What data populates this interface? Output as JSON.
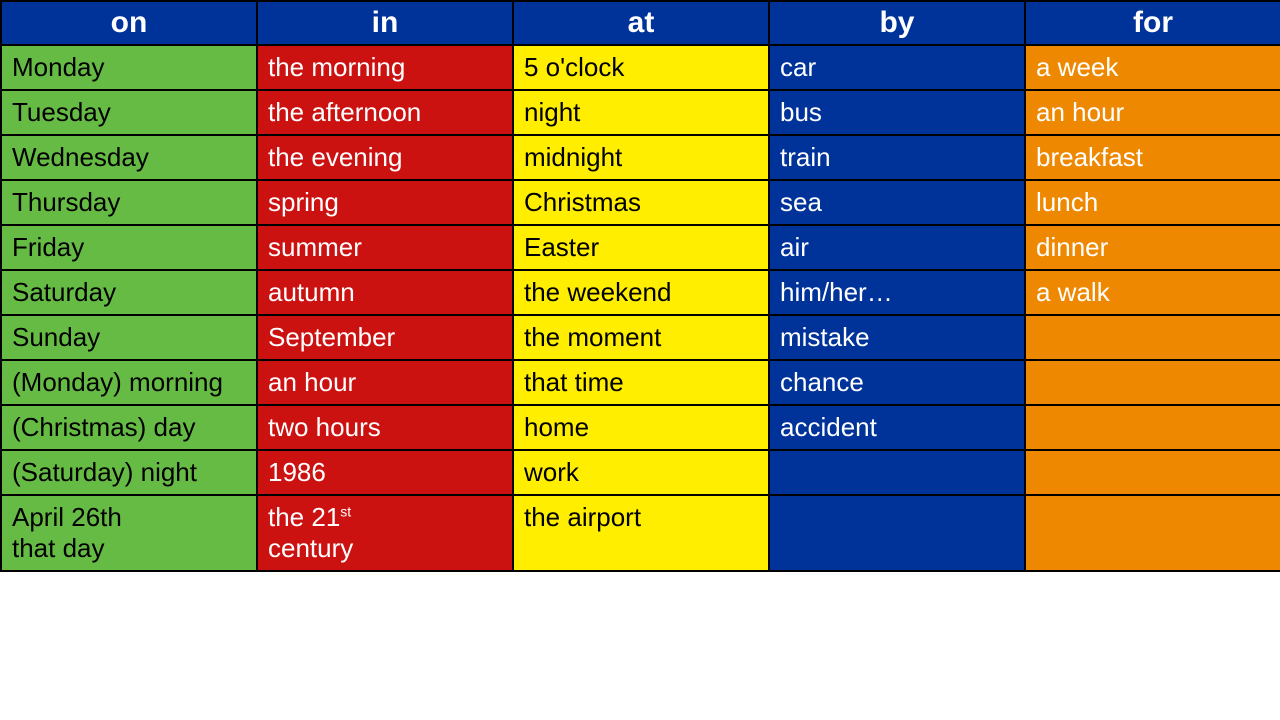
{
  "headers": {
    "on": "on",
    "in": "in",
    "at": "at",
    "by": "by",
    "for": "for"
  },
  "rows": [
    {
      "on": "Monday",
      "in": "the morning",
      "at": "5 o'clock",
      "by": "car",
      "for": "a week"
    },
    {
      "on": "Tuesday",
      "in": "the afternoon",
      "at": "night",
      "by": "bus",
      "for": "an hour"
    },
    {
      "on": "Wednesday",
      "in": "the evening",
      "at": "midnight",
      "by": "train",
      "for": "breakfast"
    },
    {
      "on": "Thursday",
      "in": "spring",
      "at": "Christmas",
      "by": "sea",
      "for": "lunch"
    },
    {
      "on": "Friday",
      "in": "summer",
      "at": "Easter",
      "by": "air",
      "for": "dinner"
    },
    {
      "on": "Saturday",
      "in": "autumn",
      "at": "the weekend",
      "by": "him/her…",
      "for": "a walk"
    },
    {
      "on": "Sunday",
      "in": "September",
      "at": "the moment",
      "by": "mistake",
      "for": ""
    },
    {
      "on": "(Monday) morning",
      "in": "an hour",
      "at": "that time",
      "by": "chance",
      "for": ""
    },
    {
      "on": "(Christmas) day",
      "in": "two hours",
      "at": "home",
      "by": "accident",
      "for": ""
    },
    {
      "on": "(Saturday) night",
      "in": "1986",
      "at": "work",
      "by": "",
      "for": ""
    },
    {
      "on": "April 26th\nthat day",
      "in": "the 21st century",
      "at": "the airport",
      "by": "",
      "for": ""
    }
  ]
}
